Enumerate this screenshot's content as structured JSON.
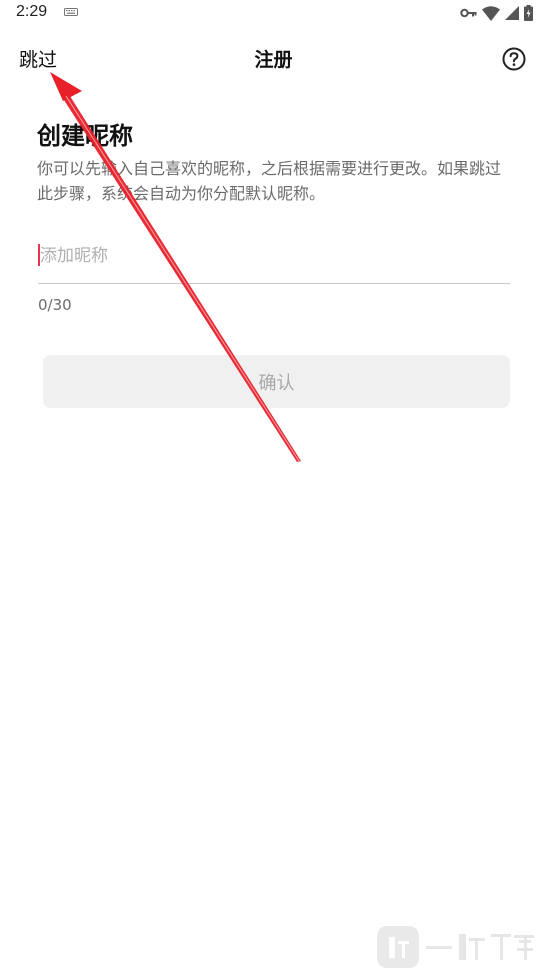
{
  "status_bar": {
    "time": "2:29",
    "icons": [
      "keyboard-icon",
      "vpn-key-icon",
      "wifi-icon",
      "cell-signal-icon",
      "battery-icon"
    ]
  },
  "header": {
    "skip_label": "跳过",
    "title": "注册",
    "help_icon": "help-circle-icon"
  },
  "content": {
    "heading": "创建昵称",
    "description": "你可以先输入自己喜欢的昵称，之后根据需要进行更改。如果跳过此步骤，系统会自动为你分配默认昵称。",
    "nickname_input": {
      "value": "",
      "placeholder": "添加昵称"
    },
    "char_counter": "0/30",
    "confirm_label": "确认"
  },
  "watermark": {
    "text": "一听下载"
  },
  "colors": {
    "caret": "#e8344e",
    "annotation_arrow": "#e8202a",
    "disabled_button_bg": "#f0f0f0",
    "disabled_button_text": "#a8a8a8"
  }
}
